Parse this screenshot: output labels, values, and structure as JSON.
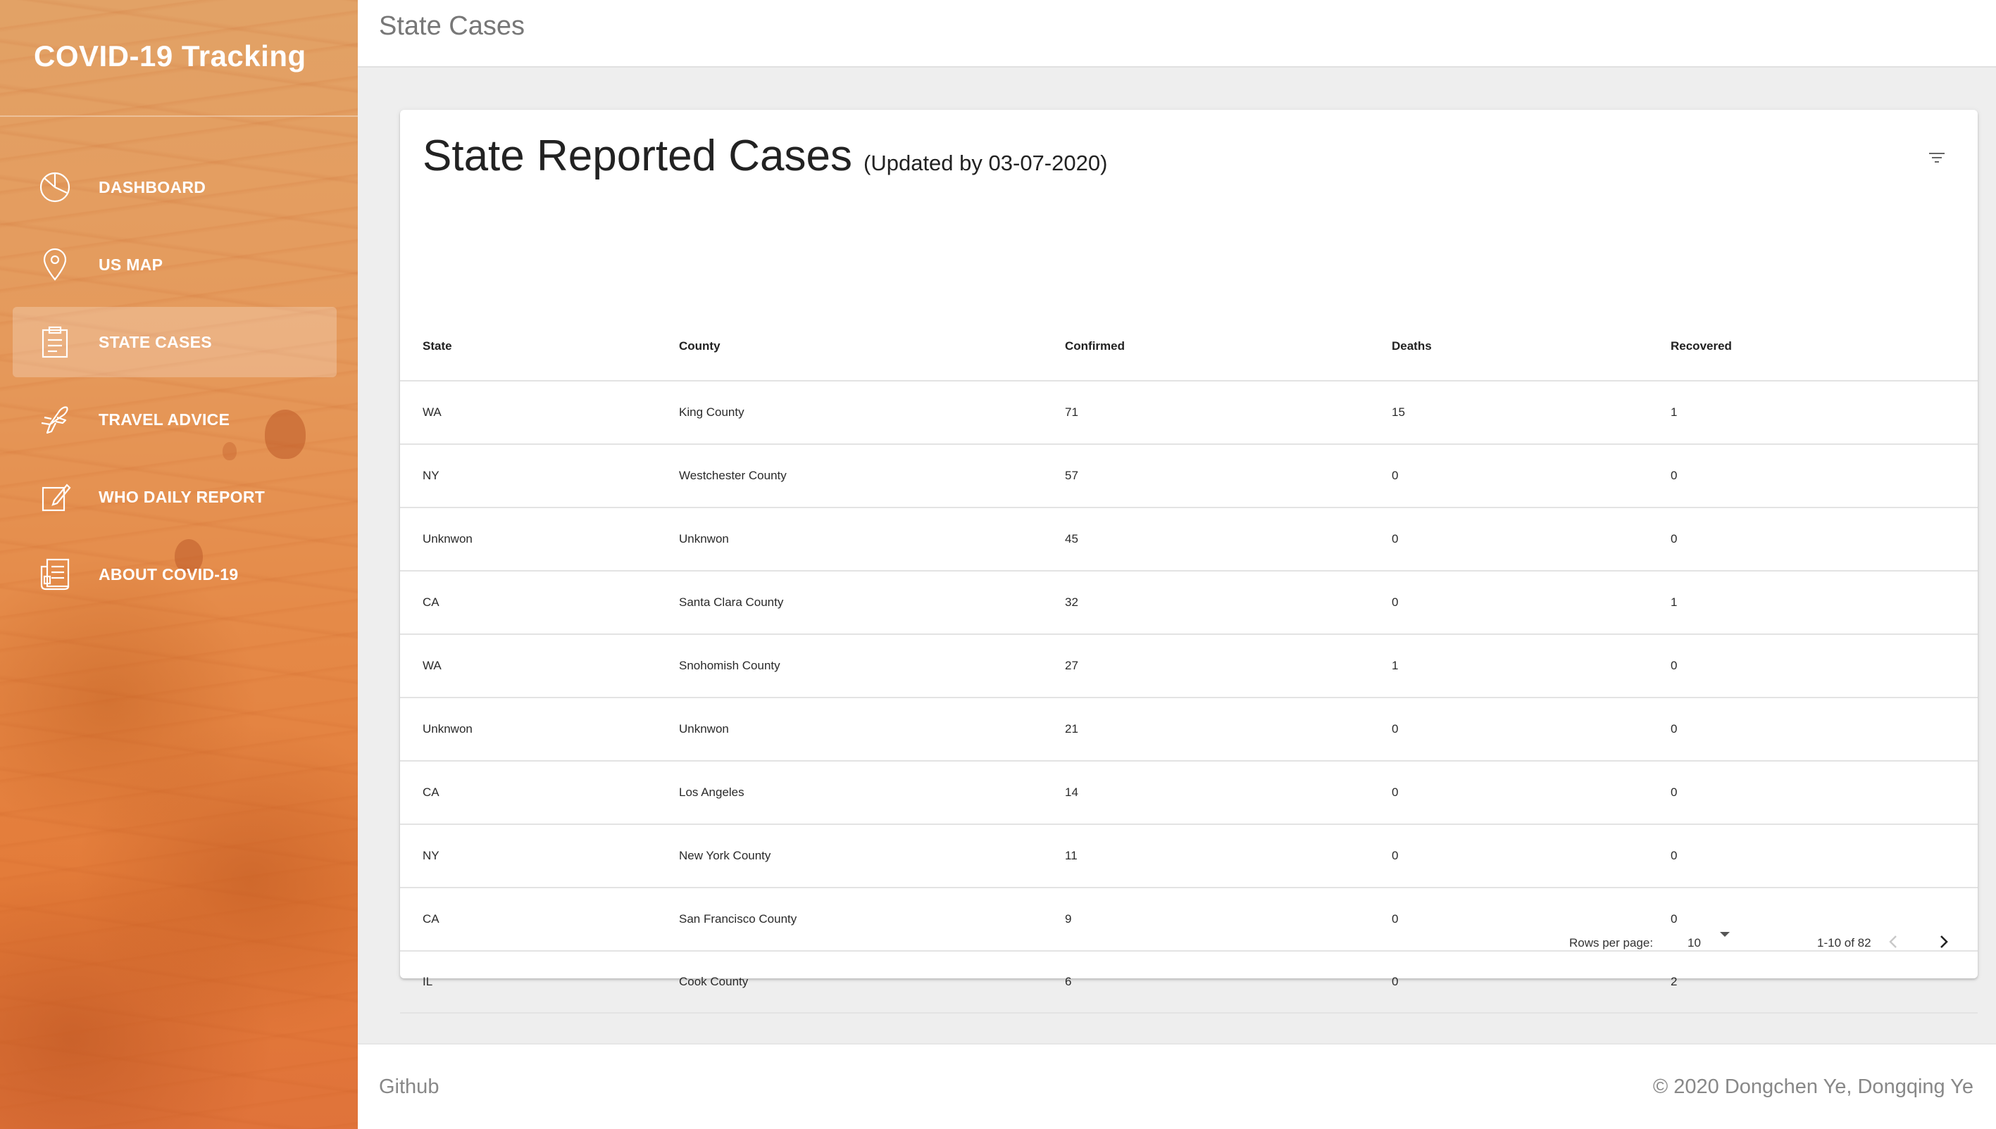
{
  "brand": {
    "title": "COVID-19 Tracking"
  },
  "nav": {
    "items": [
      {
        "label": "DASHBOARD",
        "icon": "pie-chart-icon"
      },
      {
        "label": "US MAP",
        "icon": "map-pin-icon"
      },
      {
        "label": "STATE CASES",
        "icon": "clipboard-icon",
        "active": true
      },
      {
        "label": "TRAVEL ADVICE",
        "icon": "airplane-icon"
      },
      {
        "label": "WHO DAILY REPORT",
        "icon": "edit-note-icon"
      },
      {
        "label": "ABOUT COVID-19",
        "icon": "news-document-icon"
      }
    ]
  },
  "topbar": {
    "title": "State Cases"
  },
  "card": {
    "title": "State Reported Cases",
    "subtitle": "(Updated by 03-07-2020)",
    "filter_icon": "filter-list-icon"
  },
  "table": {
    "columns": [
      "State",
      "County",
      "Confirmed",
      "Deaths",
      "Recovered"
    ],
    "rows": [
      [
        "WA",
        "King County",
        "71",
        "15",
        "1"
      ],
      [
        "NY",
        "Westchester County",
        "57",
        "0",
        "0"
      ],
      [
        "Unknwon",
        "Unknwon",
        "45",
        "0",
        "0"
      ],
      [
        "CA",
        "Santa Clara County",
        "32",
        "0",
        "1"
      ],
      [
        "WA",
        "Snohomish County",
        "27",
        "1",
        "0"
      ],
      [
        "Unknwon",
        "Unknwon",
        "21",
        "0",
        "0"
      ],
      [
        "CA",
        "Los Angeles",
        "14",
        "0",
        "0"
      ],
      [
        "NY",
        "New York County",
        "11",
        "0",
        "0"
      ],
      [
        "CA",
        "San Francisco County",
        "9",
        "0",
        "0"
      ],
      [
        "IL",
        "Cook County",
        "6",
        "0",
        "2"
      ]
    ]
  },
  "pagination": {
    "rows_per_page_label": "Rows per page:",
    "rows_per_page_value": "10",
    "range": "1-10 of 82"
  },
  "footer": {
    "link": "Github",
    "copyright": "© 2020 Dongchen Ye, Dongqing Ye"
  },
  "colors": {
    "sidebar_top": "#e2a266",
    "sidebar_bottom": "#e0733a",
    "active_item_bg": "rgba(255,255,255,0.23)"
  }
}
